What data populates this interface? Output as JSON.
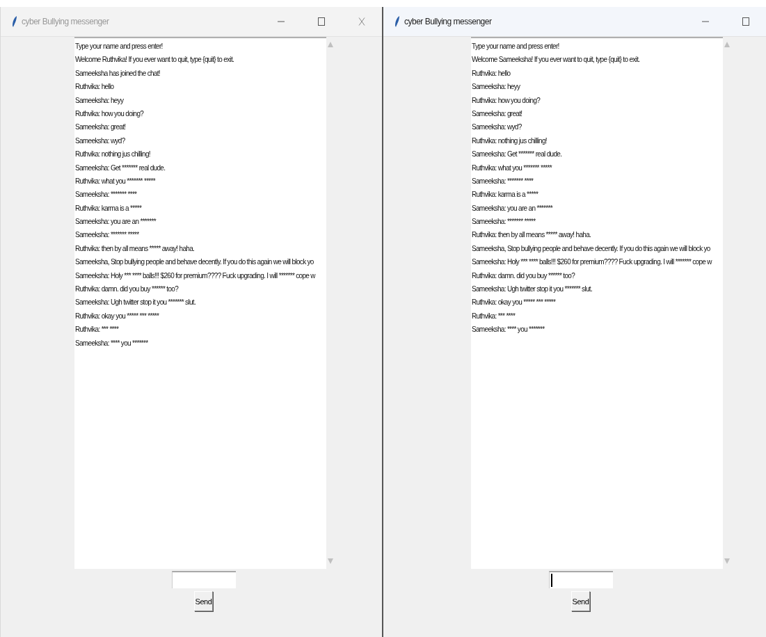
{
  "windows": [
    {
      "title": "cyber Bullying messenger",
      "active": false,
      "close_button": true,
      "messages": [
        "Type your name and press enter!",
        "Welcome Ruthvika! If you ever want to quit, type {quit} to exit.",
        "Sameeksha has joined the chat!",
        "Ruthvika: hello",
        "Sameeksha: heyy",
        "Ruthvika: how you doing?",
        "Sameeksha: great!",
        "Sameeksha: wyd?",
        "Ruthvika: nothing jus chilling!",
        "Sameeksha: Get ******* real dude.",
        "Ruthvika: what you ******* *****",
        "Sameeksha: ******* ****",
        "Ruthvika: karma is a *****",
        "Sameeksha: you are an *******",
        "Sameeksha: ******* *****",
        "Ruthvika: then by all means ***** away! haha.",
        "Sameeksha, Stop bullying people and behave decently. If you do this again we will block yo",
        "Sameeksha: Holy *** **** balls!!! $260 for premium???? Fuck upgrading. I will ******* cope w",
        "Ruthvika: damn. did you buy ****** too?",
        "Sameeksha: Ugh twitter stop it you ******* slut.",
        "Ruthvika: okay you ***** *** *****",
        "Ruthvika: *** ****",
        "Sameeksha: **** you *******"
      ],
      "entry": {
        "focused": false
      },
      "send_button": "Send"
    },
    {
      "title": "cyber Bullying messenger",
      "active": true,
      "close_button": false,
      "messages": [
        "Type your name and press enter!",
        "Welcome Sameeksha! If you ever want to quit, type {quit} to exit.",
        "Ruthvika: hello",
        "Sameeksha: heyy",
        "Ruthvika: how you doing?",
        "Sameeksha: great!",
        "Sameeksha: wyd?",
        "Ruthvika: nothing jus chilling!",
        "Sameeksha: Get ******* real dude.",
        "Ruthvika: what you ******* *****",
        "Sameeksha: ******* ****",
        "Ruthvika: karma is a *****",
        "Sameeksha: you are an *******",
        "Sameeksha: ******* *****",
        "Ruthvika: then by all means ***** away! haha.",
        "Sameeksha, Stop bullying people and behave decently. If you do this again we will block yo",
        "Sameeksha: Holy *** **** balls!!! $260 for premium???? Fuck upgrading. I will ******* cope w",
        "Ruthvika: damn. did you buy ****** too?",
        "Sameeksha: Ugh twitter stop it you ******* slut.",
        "Ruthvika: okay you ***** *** *****",
        "Ruthvika: *** ****",
        "Sameeksha: **** you *******"
      ],
      "entry": {
        "focused": true
      },
      "send_button": "Send"
    }
  ]
}
